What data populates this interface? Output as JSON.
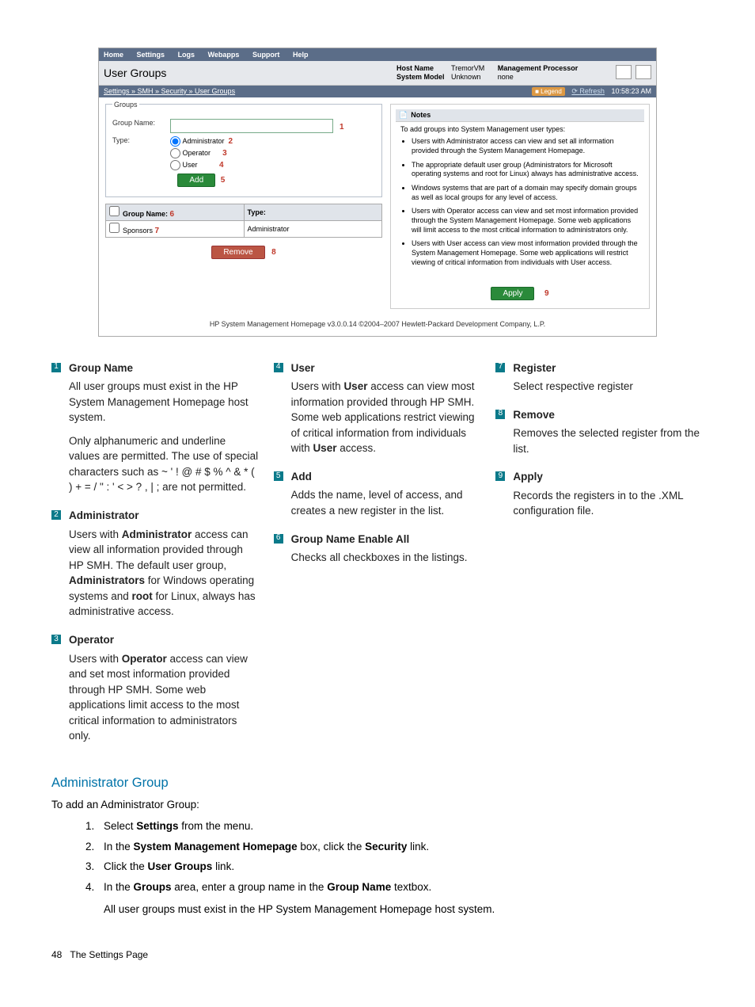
{
  "screenshot": {
    "menu": [
      "Home",
      "Settings",
      "Logs",
      "Webapps",
      "Support",
      "Help"
    ],
    "pageTitle": "User Groups",
    "info": {
      "hostNameLabel": "Host Name",
      "hostNameValue": "TremorVM",
      "systemModelLabel": "System Model",
      "systemModelValue": "Unknown",
      "mgmtProcLabel": "Management Processor",
      "mgmtProcValue": "none"
    },
    "breadcrumb": "Settings » SMH » Security » User Groups",
    "legendLabel": "Legend",
    "refreshLabel": "Refresh",
    "time": "10:58:23 AM",
    "groups": {
      "legend": "Groups",
      "groupNameLabel": "Group Name:",
      "typeLabel": "Type:",
      "radio1": "Administrator",
      "radio2": "Operator",
      "radio3": "User",
      "addBtn": "Add",
      "colGroupName": "Group Name:",
      "colType": "Type:",
      "row1Name": "Sponsors",
      "row1Type": "Administrator",
      "removeBtn": "Remove"
    },
    "notes": {
      "title": "Notes",
      "intro": "To add groups into System Management user types:",
      "bullets": [
        "Users with Administrator access can view and set all information provided through the System Management Homepage.",
        "The appropriate default user group (Administrators for Microsoft operating systems and root for Linux) always has administrative access.",
        "Windows systems that are part of a domain may specify domain groups as well as local groups for any level of access.",
        "Users with Operator access can view and set most information provided through the System Management Homepage. Some web applications will limit access to the most critical information to administrators only.",
        "Users with User access can view most information provided through the System Management Homepage. Some web applications will restrict viewing of critical information from individuals with User access."
      ]
    },
    "applyBtn": "Apply",
    "footer": "HP System Management Homepage v3.0.0.14    ©2004–2007 Hewlett-Packard Development Company, L.P."
  },
  "legendItems": {
    "i1": {
      "term": "Group Name",
      "p1": "All user groups must exist in the HP System Management Homepage host system.",
      "p2a": "Only alphanumeric and underline values are permitted. The use of special characters such as ~ ' ! @ # $ % ^ & * ( ) + = / \" : ' < > ? , | ; are not permitted."
    },
    "i2": {
      "term": "Administrator",
      "p1a": "Users with ",
      "p1b": "Administrator",
      "p1c": " access can view all information provided through HP SMH. The default user group, ",
      "p1d": "Administrators",
      "p1e": " for Windows operating systems and ",
      "p1f": "root",
      "p1g": " for Linux, always has administrative access."
    },
    "i3": {
      "term": "Operator",
      "p1a": "Users with ",
      "p1b": "Operator",
      "p1c": " access can view and set most information provided through HP SMH. Some web applications limit access to the most critical information to administrators only."
    },
    "i4": {
      "term": "User",
      "p1a": "Users with ",
      "p1b": "User",
      "p1c": " access can view most information provided through HP SMH. Some web applications restrict viewing of critical information from individuals with ",
      "p1d": "User",
      "p1e": " access."
    },
    "i5": {
      "term": "Add",
      "p1": "Adds the name, level of access, and creates a new register in the list."
    },
    "i6": {
      "term": "Group Name Enable All",
      "p1": "Checks all checkboxes in the listings."
    },
    "i7": {
      "term": "Register",
      "p1": "Select respective register"
    },
    "i8": {
      "term": "Remove",
      "p1": "Removes the selected register from the list."
    },
    "i9": {
      "term": "Apply",
      "p1": "Records the registers in to the .XML configuration file."
    }
  },
  "adminGroup": {
    "heading": "Administrator Group",
    "intro": "To add an Administrator Group:",
    "step1a": "Select ",
    "step1b": "Settings",
    "step1c": " from the menu.",
    "step2a": "In the ",
    "step2b": "System Management Homepage",
    "step2c": " box, click the ",
    "step2d": "Security",
    "step2e": " link.",
    "step3a": "Click the ",
    "step3b": "User Groups",
    "step3c": " link.",
    "step4a": "In the ",
    "step4b": "Groups",
    "step4c": " area, enter a group name in the ",
    "step4d": "Group Name",
    "step4e": " textbox.",
    "step4note": "All user groups must exist in the HP System Management Homepage host system."
  },
  "pageFooter": {
    "num": "48",
    "title": "The Settings Page"
  }
}
